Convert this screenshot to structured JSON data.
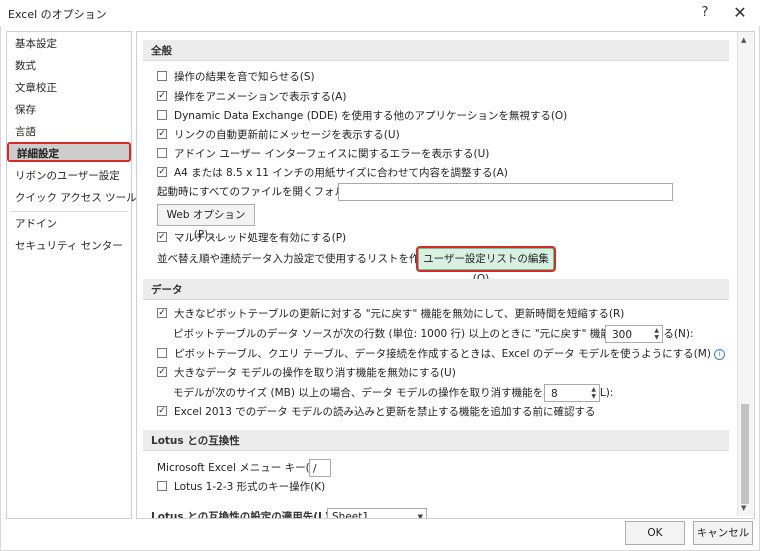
{
  "window": {
    "title": "Excel のオプション",
    "help_label": "?",
    "close_label": "✕"
  },
  "sidebar": {
    "items": [
      {
        "label": "基本設定"
      },
      {
        "label": "数式"
      },
      {
        "label": "文章校正"
      },
      {
        "label": "保存"
      },
      {
        "label": "言語"
      },
      {
        "label": "詳細設定",
        "selected": true
      },
      {
        "label": "リボンのユーザー設定"
      },
      {
        "label": "クイック アクセス ツール バー"
      },
      {
        "label": "アドイン"
      },
      {
        "label": "セキュリティ センター"
      }
    ]
  },
  "general": {
    "header": "全般",
    "options": [
      {
        "label": "操作の結果を音で知らせる(S)",
        "checked": false
      },
      {
        "label": "操作をアニメーションで表示する(A)",
        "checked": true
      },
      {
        "label": "Dynamic Data Exchange (DDE) を使用する他のアプリケーションを無視する(O)",
        "checked": false
      },
      {
        "label": "リンクの自動更新前にメッセージを表示する(U)",
        "checked": true
      },
      {
        "label": "アドイン ユーザー インターフェイスに関するエラーを表示する(U)",
        "checked": false
      },
      {
        "label": "A4 または 8.5 x 11 インチの用紙サイズに合わせて内容を調整する(A)",
        "checked": true
      }
    ],
    "startup_folder_label": "起動時にすべてのファイルを開くフォルダー(L):",
    "startup_folder_value": "",
    "web_options_label": "Web オプション(P)...",
    "multithread_label": "マルチスレッド処理を有効にする(P)",
    "multithread_checked": true,
    "custom_list_label": "並べ替え順や連続データ入力設定で使用するリストを作成します:",
    "custom_list_button": "ユーザー設定リストの編集(O)..."
  },
  "data": {
    "header": "データ",
    "undo_pivot_label": "大きなピボットテーブルの更新に対する \"元に戻す\" 機能を無効にして、更新時間を短縮する(R)",
    "undo_pivot_checked": true,
    "pivot_rows_label": "ピボットテーブルのデータ ソースが次の行数 (単位: 1000 行) 以上のときに \"元に戻す\" 機能を無効にする(N):",
    "pivot_rows_value": "300",
    "prefer_data_model_label": "ピボットテーブル、クエリ テーブル、データ接続を作成するときは、Excel のデータ モデルを使うようにする(M)",
    "prefer_data_model_checked": false,
    "info_icon": "i",
    "undo_model_label": "大きなデータ モデルの操作を取り消す機能を無効にする(U)",
    "undo_model_checked": true,
    "model_size_label": "モデルが次のサイズ (MB) 以上の場合、データ モデルの操作を取り消す機能を無効にする(L):",
    "model_size_value": "8",
    "excel2013_label": "Excel 2013 でのデータ モデルの読み込みと更新を禁止する機能を追加する前に確認する",
    "excel2013_checked": true
  },
  "lotus": {
    "header": "Lotus との互換性",
    "menu_key_label": "Microsoft Excel メニュー キー(M):",
    "menu_key_value": "/",
    "transition_keys_label": "Lotus 1-2-3 形式のキー操作(K)",
    "transition_keys_checked": false,
    "settings_label": "Lotus との互換性の設定の適用先(L):",
    "sheet_value": "Sheet1"
  },
  "footer": {
    "ok_label": "OK",
    "cancel_label": "キャンセル"
  }
}
